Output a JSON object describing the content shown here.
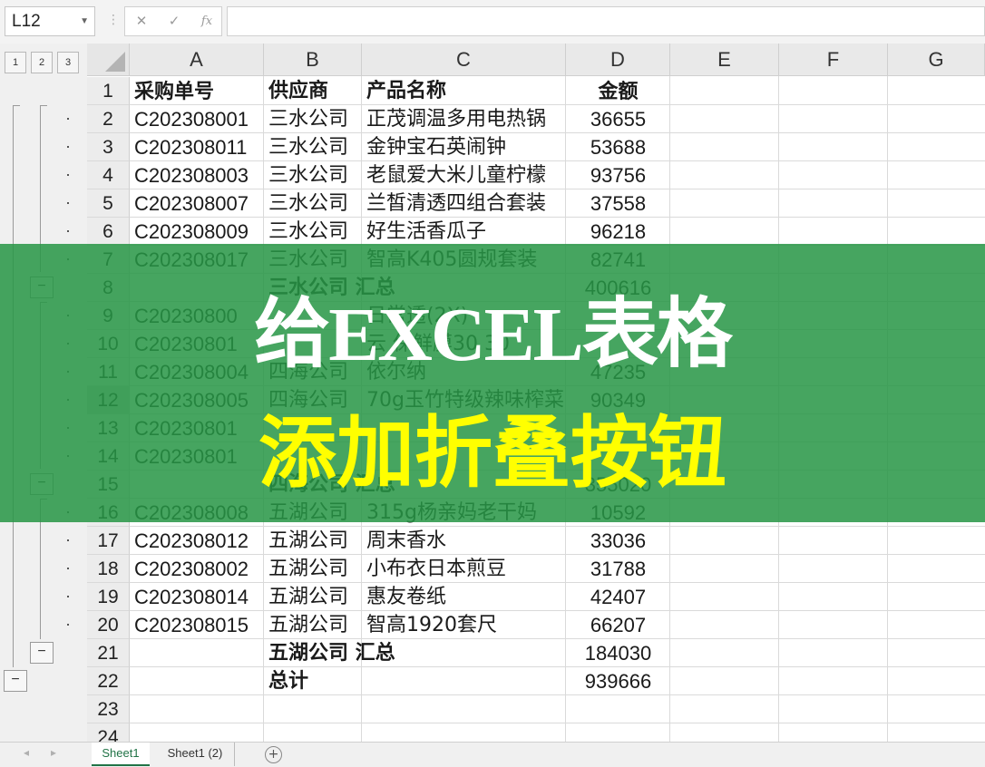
{
  "formula_bar": {
    "name_box": "L12",
    "cancel_icon": "✕",
    "enter_icon": "✓",
    "fx_label": "fx",
    "formula": ""
  },
  "outline_levels": [
    "1",
    "2",
    "3"
  ],
  "columns": [
    "A",
    "B",
    "C",
    "D",
    "E",
    "F",
    "G"
  ],
  "rows": [
    {
      "n": "1",
      "a": "采购单号",
      "b": "供应商",
      "c": "产品名称",
      "d": "金额",
      "header": true
    },
    {
      "n": "2",
      "a": "C202308001",
      "b": "三水公司",
      "c": "正茂调温多用电热锅",
      "d": "36655"
    },
    {
      "n": "3",
      "a": "C202308011",
      "b": "三水公司",
      "c": "金钟宝石英闹钟",
      "d": "53688"
    },
    {
      "n": "4",
      "a": "C202308003",
      "b": "三水公司",
      "c": "老鼠爱大米儿童柠檬",
      "d": "93756"
    },
    {
      "n": "5",
      "a": "C202308007",
      "b": "三水公司",
      "c": "兰皙清透四组合套装",
      "d": "37558"
    },
    {
      "n": "6",
      "a": "C202308009",
      "b": "三水公司",
      "c": "好生活香瓜子",
      "d": "96218"
    },
    {
      "n": "7",
      "a": "C202308017",
      "b": "三水公司",
      "c": "智高K405圆规套装",
      "d": "82741"
    },
    {
      "n": "8",
      "a": "",
      "b": "三水公司 汇总",
      "c": "",
      "d": "400616",
      "subtotal": true
    },
    {
      "n": "9",
      "a": "C20230800",
      "b": "",
      "c": "日常透(2X)",
      "d": ""
    },
    {
      "n": "10",
      "a": "C20230801",
      "b": "",
      "c": "云 保鲜膜30 30",
      "d": ""
    },
    {
      "n": "11",
      "a": "C202308004",
      "b": "四海公司",
      "c": "依尔纳",
      "d": "47235"
    },
    {
      "n": "12",
      "a": "C202308005",
      "b": "四海公司",
      "c": "70g玉竹特级辣味榨菜",
      "d": "90349"
    },
    {
      "n": "13",
      "a": "C20230801",
      "b": "",
      "c": "",
      "d": ""
    },
    {
      "n": "14",
      "a": "C20230801",
      "b": "",
      "c": "",
      "d": ""
    },
    {
      "n": "15",
      "a": "",
      "b": "四海公司 汇总",
      "c": "",
      "d": "355020",
      "subtotal": true
    },
    {
      "n": "16",
      "a": "C202308008",
      "b": "五湖公司",
      "c": "315g杨亲妈老干妈",
      "d": "10592"
    },
    {
      "n": "17",
      "a": "C202308012",
      "b": "五湖公司",
      "c": "周末香水",
      "d": "33036"
    },
    {
      "n": "18",
      "a": "C202308002",
      "b": "五湖公司",
      "c": "小布衣日本煎豆",
      "d": "31788"
    },
    {
      "n": "19",
      "a": "C202308014",
      "b": "五湖公司",
      "c": "惠友卷纸",
      "d": "42407"
    },
    {
      "n": "20",
      "a": "C202308015",
      "b": "五湖公司",
      "c": "智高1920套尺",
      "d": "66207"
    },
    {
      "n": "21",
      "a": "",
      "b": "五湖公司 汇总",
      "c": "",
      "d": "184030",
      "subtotal": true
    },
    {
      "n": "22",
      "a": "",
      "b": "总计",
      "c": "",
      "d": "939666",
      "subtotal": true
    },
    {
      "n": "23",
      "a": "",
      "b": "",
      "c": "",
      "d": ""
    },
    {
      "n": "24",
      "a": "",
      "b": "",
      "c": "",
      "d": ""
    }
  ],
  "banner": {
    "line1": "给EXCEL表格",
    "line2": "添加折叠按钮",
    "line1_color": "#ffffff",
    "line2_color": "#ffff00",
    "background": "#2e9a4e"
  },
  "sheet_tabs": [
    "Sheet1",
    "Sheet1 (2)"
  ],
  "active_tab": "Sheet1",
  "collapse_symbol": "−"
}
